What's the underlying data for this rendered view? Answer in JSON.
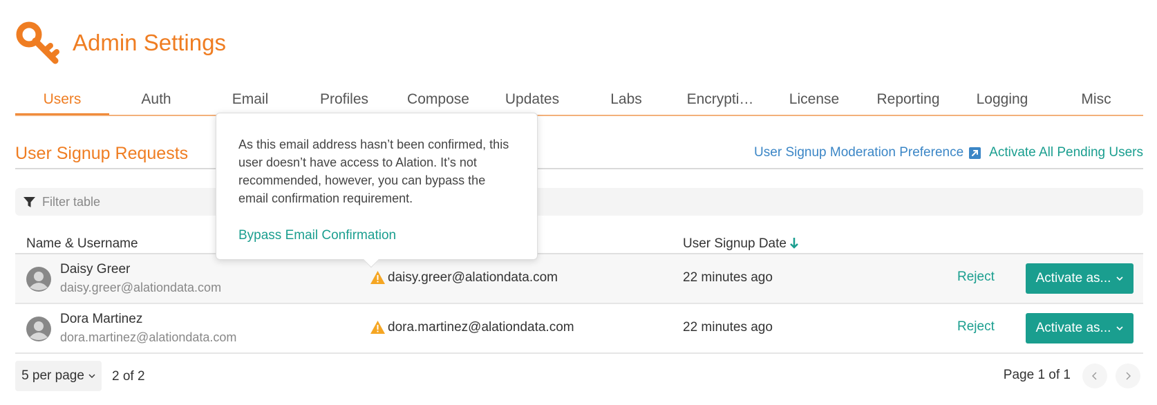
{
  "app": {
    "title": "Admin Settings",
    "accent_color": "#ef7d22",
    "link_color": "#1a9e8f",
    "icon": "key-icon"
  },
  "tabs": [
    {
      "label": "Users",
      "active": true
    },
    {
      "label": "Auth"
    },
    {
      "label": "Email"
    },
    {
      "label": "Profiles"
    },
    {
      "label": "Compose"
    },
    {
      "label": "Updates"
    },
    {
      "label": "Labs"
    },
    {
      "label": "Encrypti…"
    },
    {
      "label": "License"
    },
    {
      "label": "Reporting"
    },
    {
      "label": "Logging"
    },
    {
      "label": "Misc"
    }
  ],
  "section": {
    "title": "User Signup Requests",
    "moderation_link": "User Signup Moderation Preference",
    "activate_all": "Activate All Pending Users"
  },
  "filter": {
    "placeholder": "Filter table",
    "icon": "filter-icon"
  },
  "table": {
    "headers": {
      "name": "Name & Username",
      "date": "User Signup Date"
    },
    "sort": {
      "column": "User Signup Date",
      "direction": "descending"
    },
    "rows": [
      {
        "name": "Daisy Greer",
        "username": "daisy.greer@alationdata.com",
        "email": "daisy.greer@alationdata.com",
        "date": "22 minutes ago",
        "reject": "Reject",
        "activate": "Activate as..."
      },
      {
        "name": "Dora Martinez",
        "username": "dora.martinez@alationdata.com",
        "email": "dora.martinez@alationdata.com",
        "date": "22 minutes ago",
        "reject": "Reject",
        "activate": "Activate as..."
      }
    ]
  },
  "pagination": {
    "per_page": "5 per page",
    "count": "2 of 2",
    "page_label": "Page 1 of 1"
  },
  "popover": {
    "text": "As this email address hasn’t been confirmed, this user doesn’t have access to Alation. It’s not recommended, however, you can bypass the email confirmation requirement.",
    "link": "Bypass Email Confirmation"
  }
}
